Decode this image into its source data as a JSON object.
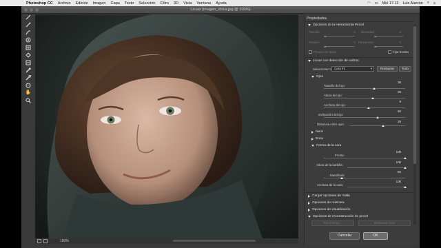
{
  "menubar": {
    "app_name": "Photoshop CC",
    "items": [
      "Archivo",
      "Edición",
      "Imagen",
      "Capa",
      "Texto",
      "Selección",
      "Filtro",
      "3D",
      "Vista",
      "Ventana",
      "Ayuda"
    ],
    "clock": "Mié 17:13",
    "user": "Luis Alarcón"
  },
  "window": {
    "title": "Licuar (imagen_chica.jpg @ 100%)"
  },
  "status": {
    "zoom": "100%"
  },
  "panel": {
    "title": "Propiedades",
    "brush_section": "Opciones de la Herramienta Pincel",
    "brush_fields": {
      "tamano_label": "Tamaño:",
      "tamano_value": "0",
      "densidad_label": "Densidad:",
      "densidad_value": "0",
      "presion_label": "Presión:",
      "presion_value": "0",
      "frecuencia_label": "Frecuencia:",
      "frecuencia_value": "0",
      "presion_stylus": "Presión de stylus",
      "fijar_bordes": "Fijar bordes"
    },
    "face_section": "Licuar con detección de rostros",
    "select_face_label": "Seleccionar cara:",
    "select_face_value": "Cara #1",
    "restore_label": "Restaurar",
    "all_label": "Todo",
    "eyes": {
      "header": "Ojos",
      "rows": [
        {
          "label": "Tamaño del ojo:",
          "value": "39",
          "level": 0.62
        },
        {
          "label": "Altura del ojo:",
          "value": "25",
          "level": 0.6
        },
        {
          "label": "Anchura del ojo:",
          "value": "9",
          "level": 0.55
        },
        {
          "label": "Inclinación del ojo:",
          "value": "60",
          "level": 0.66
        },
        {
          "label": "Distancia entre ojos:",
          "value": "29",
          "level": 0.6
        }
      ]
    },
    "nose": "Nariz",
    "mouth": "Boca",
    "face_shape": {
      "header": "Forma de la cara",
      "rows": [
        {
          "label": "Frente:",
          "value": "100",
          "level": 1.0
        },
        {
          "label": "Altura de la barbilla:",
          "value": "100",
          "level": 1.0
        },
        {
          "label": "Mandíbula:",
          "value": "-56",
          "level": 0.22
        },
        {
          "label": "Anchura de la cara:",
          "value": "100",
          "level": 1.0
        }
      ]
    },
    "collapsed": [
      "Cargar opciones de malla",
      "Opciones de máscara",
      "Opciones de visualización"
    ],
    "reconstruct": "Opciones de reconstrucción de pincel",
    "reconstruct_btn": "Reconstruir...",
    "restore_all_btn": "Restaurar todo"
  },
  "dialog": {
    "cancel": "Cancelar",
    "ok": "OK"
  }
}
